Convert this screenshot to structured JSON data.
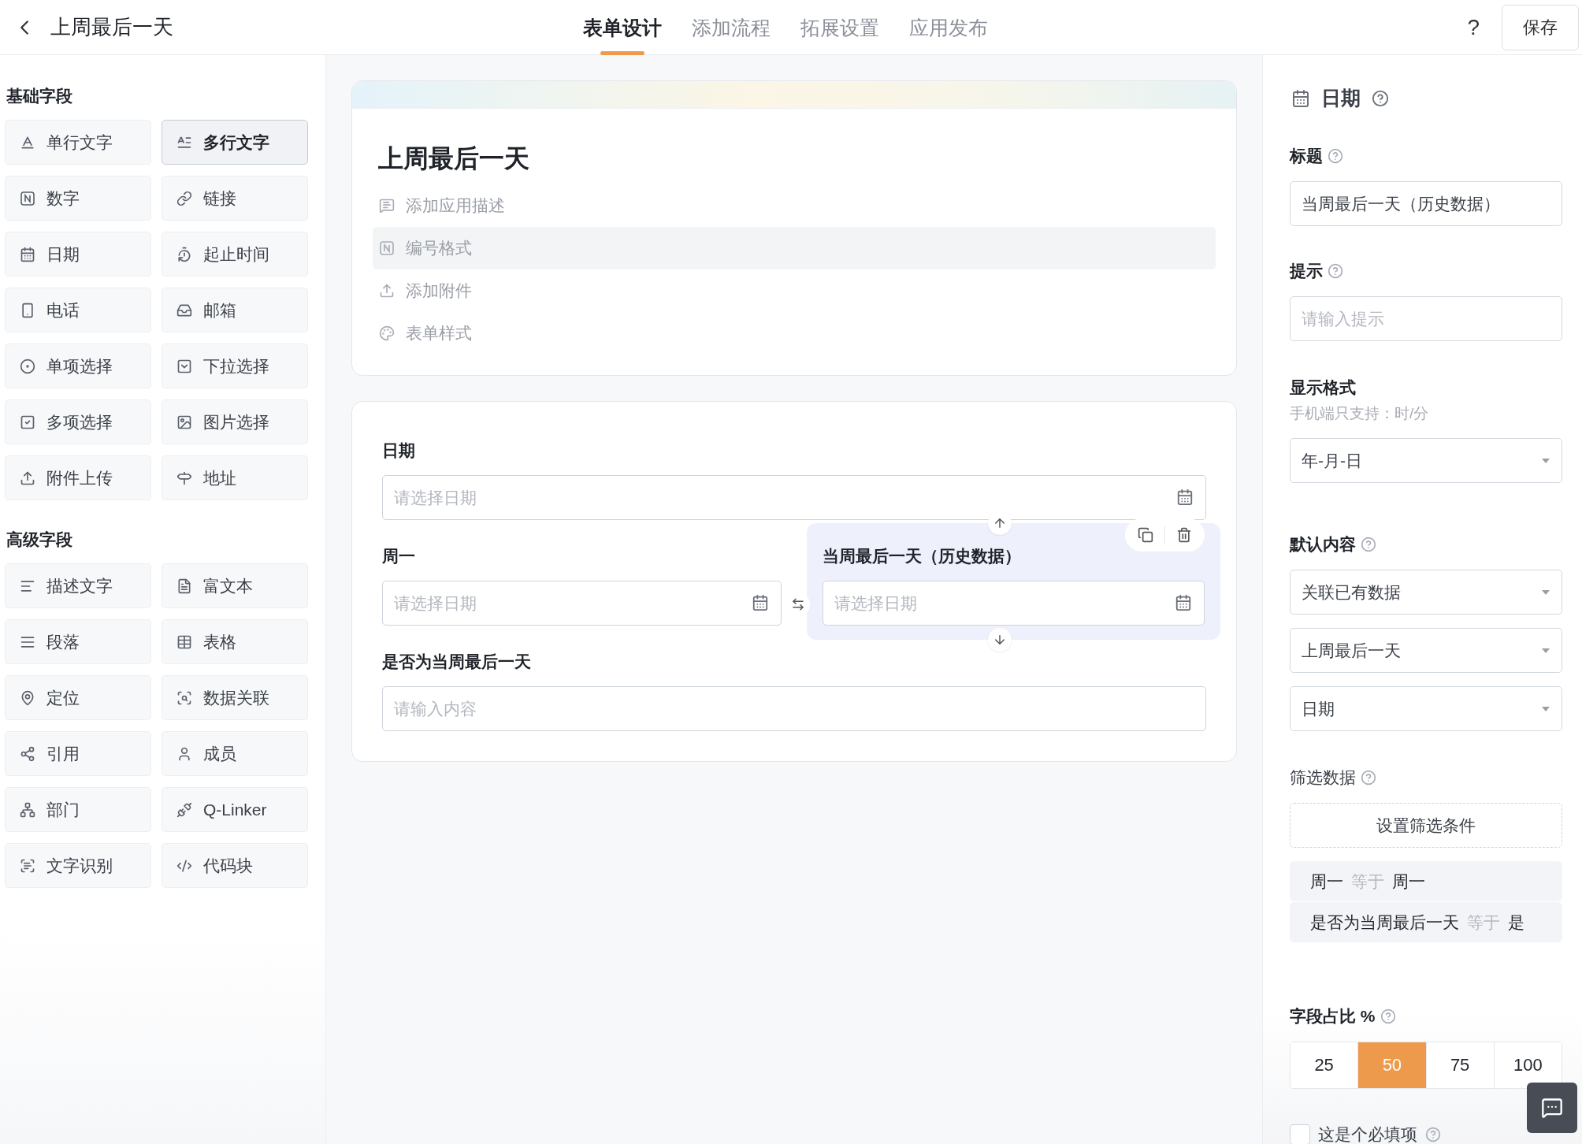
{
  "header": {
    "title": "上周最后一天",
    "tabs": [
      {
        "label": "表单设计",
        "selected": true
      },
      {
        "label": "添加流程",
        "selected": false
      },
      {
        "label": "拓展设置",
        "selected": false
      },
      {
        "label": "应用发布",
        "selected": false
      }
    ],
    "help": "?",
    "save": "保存"
  },
  "sidebar": {
    "sections": [
      {
        "title": "基础字段",
        "items": [
          {
            "label": "单行文字",
            "selected": false
          },
          {
            "label": "多行文字",
            "selected": true
          },
          {
            "label": "数字",
            "selected": false
          },
          {
            "label": "链接",
            "selected": false
          },
          {
            "label": "日期",
            "selected": false
          },
          {
            "label": "起止时间",
            "selected": false
          },
          {
            "label": "电话",
            "selected": false
          },
          {
            "label": "邮箱",
            "selected": false
          },
          {
            "label": "单项选择",
            "selected": false
          },
          {
            "label": "下拉选择",
            "selected": false
          },
          {
            "label": "多项选择",
            "selected": false
          },
          {
            "label": "图片选择",
            "selected": false
          },
          {
            "label": "附件上传",
            "selected": false
          },
          {
            "label": "地址",
            "selected": false
          }
        ]
      },
      {
        "title": "高级字段",
        "items": [
          {
            "label": "描述文字",
            "selected": false
          },
          {
            "label": "富文本",
            "selected": false
          },
          {
            "label": "段落",
            "selected": false
          },
          {
            "label": "表格",
            "selected": false
          },
          {
            "label": "定位",
            "selected": false
          },
          {
            "label": "数据关联",
            "selected": false
          },
          {
            "label": "引用",
            "selected": false
          },
          {
            "label": "成员",
            "selected": false
          },
          {
            "label": "部门",
            "selected": false
          },
          {
            "label": "Q-Linker",
            "selected": false
          },
          {
            "label": "文字识别",
            "selected": false
          },
          {
            "label": "代码块",
            "selected": false
          }
        ]
      }
    ]
  },
  "form_header": {
    "title": "上周最后一天",
    "options": [
      {
        "label": "添加应用描述",
        "highlighted": false
      },
      {
        "label": "编号格式",
        "highlighted": true
      },
      {
        "label": "添加附件",
        "highlighted": false
      },
      {
        "label": "表单样式",
        "highlighted": false
      }
    ]
  },
  "form": {
    "rows": [
      [
        {
          "label": "日期",
          "kind": "date",
          "placeholder": "请选择日期",
          "selected": false
        }
      ],
      [
        {
          "label": "周一",
          "kind": "date",
          "placeholder": "请选择日期",
          "selected": false
        },
        {
          "label": "当周最后一天（历史数据）",
          "kind": "date",
          "placeholder": "请选择日期",
          "selected": true
        }
      ],
      [
        {
          "label": "是否为当周最后一天",
          "kind": "text",
          "placeholder": "请输入内容",
          "selected": false
        }
      ]
    ]
  },
  "properties": {
    "title": "日期",
    "sections": [
      {
        "kind": "input",
        "label": "标题",
        "help": true,
        "value": "当周最后一天（历史数据）"
      },
      {
        "kind": "input",
        "label": "提示",
        "help": true,
        "placeholder": "请输入提示"
      },
      {
        "kind": "select",
        "label": "显示格式",
        "help": false,
        "hint": "手机端只支持：时/分",
        "values": [
          "年-月-日"
        ]
      },
      {
        "kind": "select",
        "label": "默认内容",
        "help": true,
        "values": [
          "关联已有数据",
          "上周最后一天",
          "日期"
        ]
      },
      {
        "kind": "filter",
        "label": "筛选数据",
        "help": true,
        "button": "设置筛选条件",
        "conditions": [
          {
            "field": "周一",
            "operator": "等于",
            "value": "周一"
          },
          {
            "field": "是否为当周最后一天",
            "operator": "等于",
            "value": "是"
          }
        ]
      },
      {
        "kind": "segments",
        "label": "字段占比 %",
        "help": true,
        "options": [
          {
            "label": "25",
            "selected": false
          },
          {
            "label": "50",
            "selected": true
          },
          {
            "label": "75",
            "selected": false
          },
          {
            "label": "100",
            "selected": false
          }
        ]
      },
      {
        "kind": "checkbox",
        "label": "这是个必填项",
        "help": true,
        "checked": false
      }
    ]
  }
}
